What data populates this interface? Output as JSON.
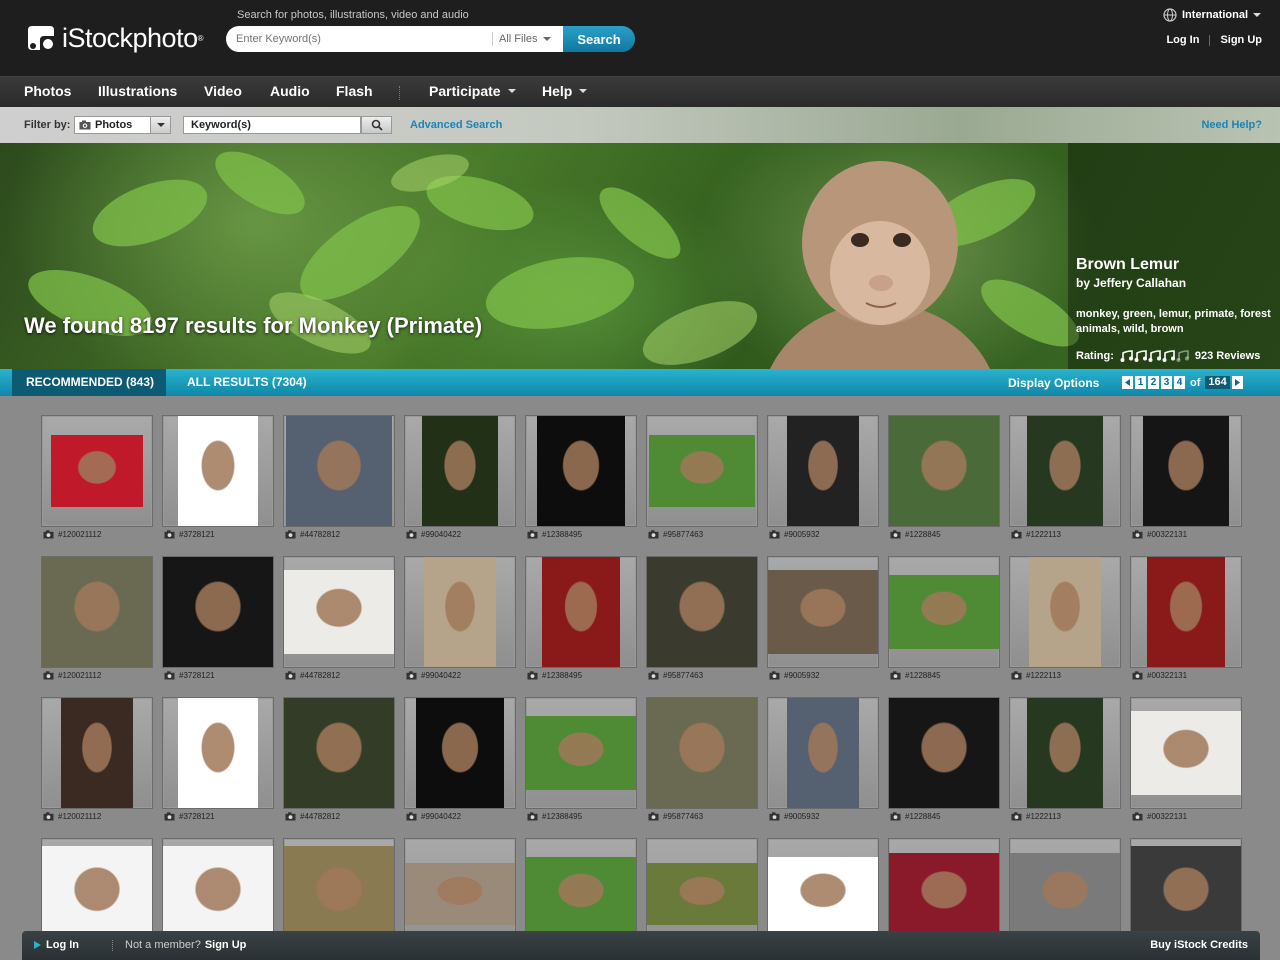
{
  "header": {
    "logo_text": "iStockphoto",
    "search_caption": "Search for photos, illustrations, video and audio",
    "search_placeholder": "Enter Keyword(s)",
    "file_type": "All Files",
    "search_button": "Search",
    "international": "International",
    "login": "Log In",
    "signup": "Sign Up"
  },
  "nav": {
    "items": [
      "Photos",
      "Illustrations",
      "Video",
      "Audio",
      "Flash",
      "Participate",
      "Help"
    ]
  },
  "filter": {
    "label": "Filter by:",
    "selected": "Photos",
    "keyword_value": "Keyword(s)",
    "advanced": "Advanced Search",
    "help": "Need Help?"
  },
  "hero": {
    "headline": "We found 8197 results for Monkey (Primate)",
    "feature_title": "Brown Lemur",
    "feature_author": "by Jeffery Callahan",
    "feature_tags": "monkey, green, lemur, primate, forest animals, wild, brown",
    "rating_label": "Rating:",
    "rating_value": 4,
    "rating_max": 5,
    "reviews": "923 Reviews"
  },
  "results_bar": {
    "tab_recommended": "RECOMMENDED (843)",
    "tab_all": "ALL RESULTS (7304)",
    "display_options": "Display Options",
    "pages": [
      "1",
      "2",
      "3",
      "4"
    ],
    "of_label": "of",
    "total_pages": "164"
  },
  "results": {
    "row_ids": [
      "#120021112",
      "#3728121",
      "#44782812",
      "#99040422",
      "#12388495",
      "#95877463",
      "#9005932",
      "#1228845",
      "#1222113",
      "#00322131"
    ]
  },
  "bottom_bar": {
    "login": "Log In",
    "not_member": "Not a member?",
    "signup": "Sign Up",
    "buy": "Buy iStock Credits"
  },
  "colors": {
    "accent": "#1b84b8",
    "tab_bar": "#1a9dbf",
    "header_bg": "#1e1e1e"
  }
}
